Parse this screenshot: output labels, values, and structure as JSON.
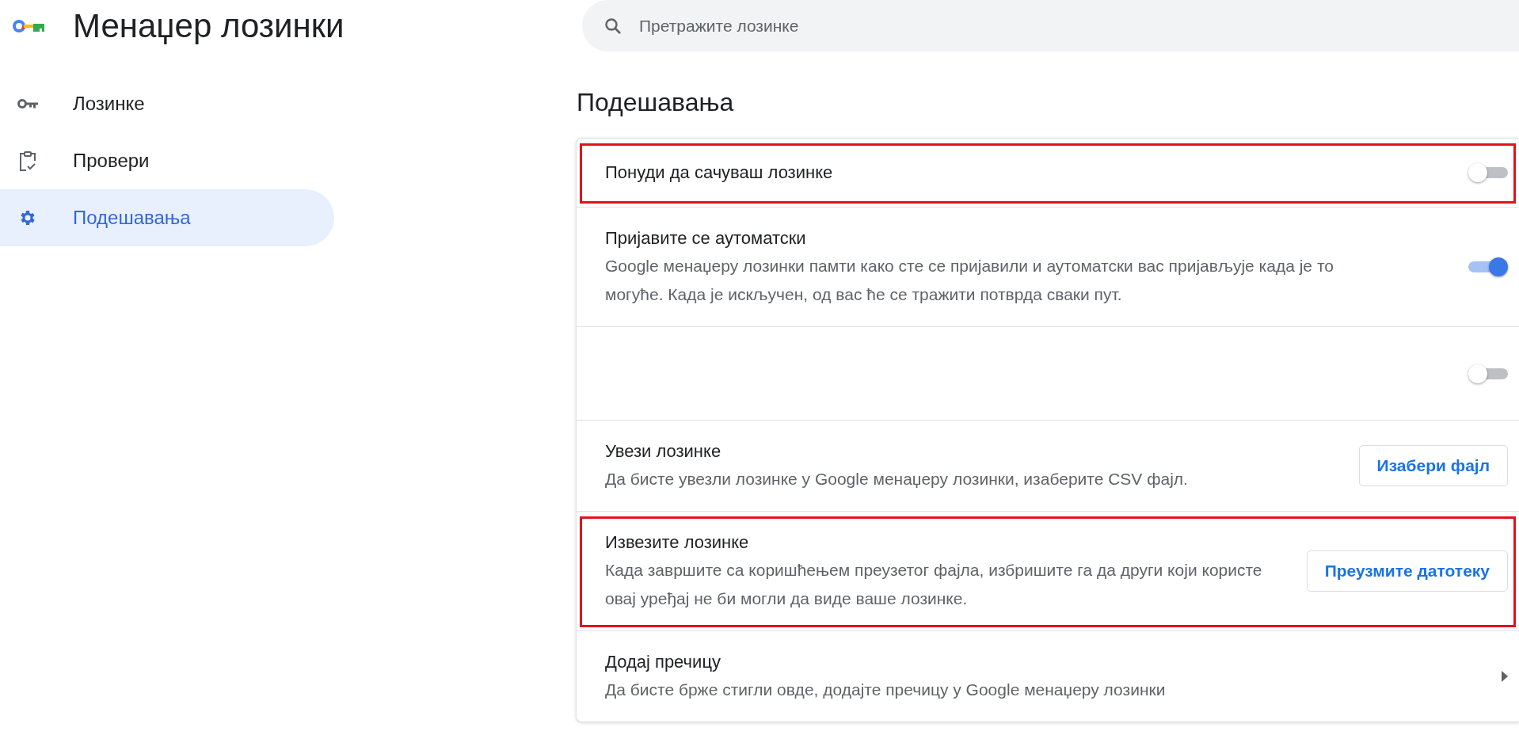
{
  "app": {
    "title": "Менаџер лозинки"
  },
  "search": {
    "placeholder": "Претражите лозинке"
  },
  "sidebar": {
    "items": [
      {
        "kind": "key",
        "label": "Лозинке",
        "selected": false
      },
      {
        "kind": "checkup",
        "label": "Провери",
        "selected": false
      },
      {
        "kind": "settings",
        "label": "Подешавања",
        "selected": true
      }
    ]
  },
  "settings": {
    "heading": "Подешавања",
    "rows": [
      {
        "kind": "toggle",
        "title": "Понуди да сачуваш лозинке",
        "on": false,
        "highlighted": true
      },
      {
        "kind": "toggle",
        "title": "Пријавите се аутоматски",
        "description": "Google менаџеру лозинки памти како сте се пријавили и аутоматски вас пријављује када је то могуће. Када је искључен, од вас ће се тражити потврда сваки пут.",
        "on": true,
        "highlighted": false
      },
      {
        "kind": "toggle",
        "on": false,
        "highlighted": false
      },
      {
        "kind": "button",
        "title": "Увези лозинке",
        "description": "Да бисте увезли лозинке у Google менаџеру лозинки, изаберите CSV фајл.",
        "button": "Изабери фајл",
        "highlighted": false
      },
      {
        "kind": "button",
        "title": "Извезите лозинке",
        "description": "Када завршите са коришћењем преузетог фајла, избришите га да други који користе овај уређај не би могли да виде ваше лозинке.",
        "button": "Преузмите датотеку",
        "highlighted": true
      },
      {
        "kind": "link",
        "title": "Додај пречицу",
        "description": "Да бисте брже стигли овде, додајте пречицу у Google менаџеру лозинки",
        "highlighted": false
      }
    ]
  }
}
